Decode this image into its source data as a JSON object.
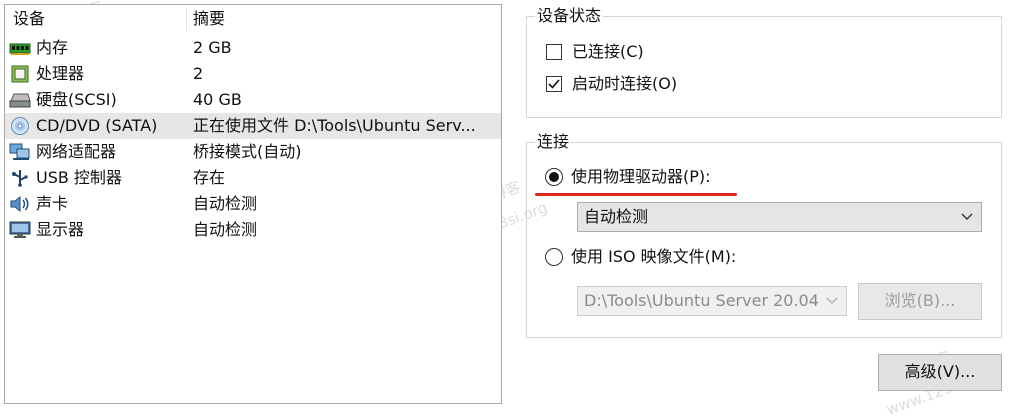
{
  "device_list": {
    "col_device": "设备",
    "col_summary": "摘要",
    "rows": [
      {
        "name": "内存",
        "summary": "2 GB",
        "icon": "memory-icon"
      },
      {
        "name": "处理器",
        "summary": "2",
        "icon": "processor-icon"
      },
      {
        "name": "硬盘(SCSI)",
        "summary": "40 GB",
        "icon": "hard-disk-icon"
      },
      {
        "name": "CD/DVD (SATA)",
        "summary": "正在使用文件 D:\\Tools\\Ubuntu Serv...",
        "icon": "cd-dvd-icon",
        "selected": true
      },
      {
        "name": "网络适配器",
        "summary": "桥接模式(自动)",
        "icon": "network-adapter-icon"
      },
      {
        "name": "USB 控制器",
        "summary": "存在",
        "icon": "usb-icon"
      },
      {
        "name": "声卡",
        "summary": "自动检测",
        "icon": "sound-card-icon"
      },
      {
        "name": "显示器",
        "summary": "自动检测",
        "icon": "display-icon"
      }
    ]
  },
  "device_status": {
    "title": "设备状态",
    "connected": {
      "label": "已连接(C)",
      "checked": false
    },
    "connect_at_power_on": {
      "label": "启动时连接(O)",
      "checked": true
    }
  },
  "connection": {
    "title": "连接",
    "physical_drive": {
      "label": "使用物理驱动器(P):",
      "selected": true,
      "dropdown_value": "自动检测"
    },
    "iso_image": {
      "label": "使用 ISO 映像文件(M):",
      "selected": false,
      "path_value": "D:\\Tools\\Ubuntu Server 20.04",
      "browse_label": "浏览(B)..."
    }
  },
  "advanced_button": "高级(V)...",
  "watermarks": [
    "123si博客",
    "www.123si.org"
  ],
  "colors": {
    "annotation_underline": "#e0241b",
    "selected_row": "#e6e6e6"
  }
}
